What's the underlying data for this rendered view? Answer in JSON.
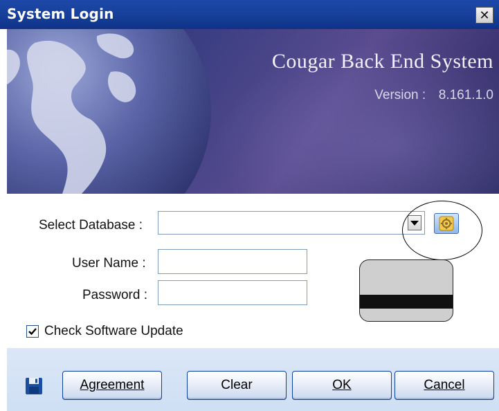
{
  "window": {
    "title": "System Login",
    "close_glyph": "✕"
  },
  "banner": {
    "app_title": "Cougar Back End System",
    "version_label": "Version :",
    "version_value": "8.161.1.0"
  },
  "form": {
    "database_label": "Select Database :",
    "database_value": "",
    "username_label": "User Name :",
    "username_value": "",
    "password_label": "Password :",
    "password_value": "",
    "check_update_label": "Check Software Update",
    "check_update_checked": true
  },
  "buttons": {
    "agreement": "Agreement",
    "clear": "Clear",
    "ok": "OK",
    "cancel": "Cancel"
  },
  "icons": [
    "close-icon",
    "globe-image",
    "dropdown-arrow-icon",
    "database-config-icon",
    "card-reader-icon",
    "save-disk-icon",
    "checkmark-icon"
  ],
  "colors": {
    "titlebar": "#163f99",
    "banner": "#3d3f84",
    "button_border": "#0b3f9a",
    "bottom_bar": "#d5e3f6"
  }
}
